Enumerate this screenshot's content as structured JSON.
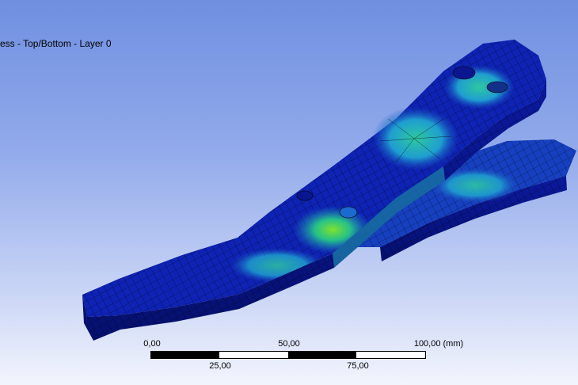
{
  "viewport": {
    "result_label": "ess - Top/Bottom - Layer 0"
  },
  "scale_bar": {
    "top_labels": [
      "0,00",
      "50,00",
      "100,00 (mm)"
    ],
    "bottom_labels": [
      "25,00",
      "75,00"
    ]
  },
  "colors": {
    "background_top": "#6f8fe0",
    "background_bottom": "#f3f5fd",
    "model_low": "#0a1aa8",
    "model_mid": "#1fb3c8",
    "model_high": "#79e02a",
    "mesh_lines": "#000000"
  }
}
